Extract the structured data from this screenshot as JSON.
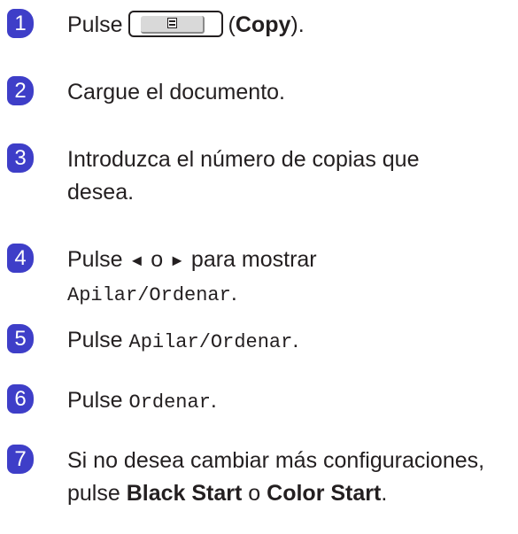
{
  "steps": [
    {
      "number": "1",
      "pre": "Pulse",
      "open_paren": "(",
      "bold": "Copy",
      "close": ")."
    },
    {
      "number": "2",
      "text": "Cargue el documento."
    },
    {
      "number": "3",
      "text": "Introduzca el número de copias que desea."
    },
    {
      "number": "4",
      "pre": "Pulse",
      "left_arrow": "◄",
      "o": "o",
      "right_arrow": "►",
      "post": "para mostrar",
      "mono": "Apilar/Ordenar",
      "end": "."
    },
    {
      "number": "5",
      "pre": "Pulse",
      "mono": "Apilar/Ordenar",
      "end": "."
    },
    {
      "number": "6",
      "pre": "Pulse",
      "mono": "Ordenar",
      "end": "."
    },
    {
      "number": "7",
      "pre": "Si no desea cambiar más configuraciones, pulse",
      "bold1": "Black Start",
      "o": "o",
      "bold2": "Color Start",
      "end": "."
    }
  ],
  "icons": {
    "copy_button": "copy-icon"
  },
  "colors": {
    "badge": "#3e3ec8",
    "text": "#231f20"
  }
}
